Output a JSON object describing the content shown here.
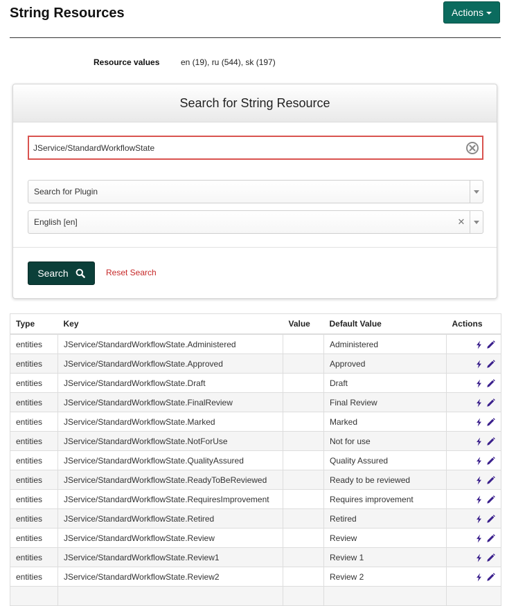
{
  "page": {
    "title": "String Resources",
    "actions_label": "Actions"
  },
  "resource_values": {
    "label": "Resource values",
    "value": "en (19), ru (544), sk (197)"
  },
  "search_panel": {
    "title": "Search for String Resource",
    "query_value": "JService/StandardWorkflowState",
    "plugin_select": "Search for Plugin",
    "language_select": "English [en]",
    "search_label": "Search",
    "reset_label": "Reset Search"
  },
  "table": {
    "headers": [
      "Type",
      "Key",
      "Value",
      "Default Value",
      "Actions"
    ],
    "rows": [
      {
        "type": "entities",
        "key": "JService/StandardWorkflowState.Administered",
        "value": "",
        "default": "Administered"
      },
      {
        "type": "entities",
        "key": "JService/StandardWorkflowState.Approved",
        "value": "",
        "default": "Approved"
      },
      {
        "type": "entities",
        "key": "JService/StandardWorkflowState.Draft",
        "value": "",
        "default": "Draft"
      },
      {
        "type": "entities",
        "key": "JService/StandardWorkflowState.FinalReview",
        "value": "",
        "default": "Final Review"
      },
      {
        "type": "entities",
        "key": "JService/StandardWorkflowState.Marked",
        "value": "",
        "default": "Marked"
      },
      {
        "type": "entities",
        "key": "JService/StandardWorkflowState.NotForUse",
        "value": "",
        "default": "Not for use"
      },
      {
        "type": "entities",
        "key": "JService/StandardWorkflowState.QualityAssured",
        "value": "",
        "default": "Quality Assured"
      },
      {
        "type": "entities",
        "key": "JService/StandardWorkflowState.ReadyToBeReviewed",
        "value": "",
        "default": "Ready to be reviewed"
      },
      {
        "type": "entities",
        "key": "JService/StandardWorkflowState.RequiresImprovement",
        "value": "",
        "default": "Requires improvement"
      },
      {
        "type": "entities",
        "key": "JService/StandardWorkflowState.Retired",
        "value": "",
        "default": "Retired"
      },
      {
        "type": "entities",
        "key": "JService/StandardWorkflowState.Review",
        "value": "",
        "default": "Review"
      },
      {
        "type": "entities",
        "key": "JService/StandardWorkflowState.Review1",
        "value": "",
        "default": "Review 1"
      },
      {
        "type": "entities",
        "key": "JService/StandardWorkflowState.Review2",
        "value": "",
        "default": "Review 2"
      },
      {
        "type": "",
        "key": "",
        "value": "",
        "default": ""
      }
    ]
  },
  "colors": {
    "primary": "#0b6b5e",
    "dark_primary": "#0b3f39",
    "error_border": "#d9534f",
    "link_red": "#c62828",
    "icon_purple": "#3a1f8c"
  },
  "icons": {
    "clear": "circle-x-icon",
    "search": "magnifier-icon",
    "caret": "caret-down-icon",
    "row_action_1": "bolt-icon",
    "row_action_2": "pencil-icon"
  }
}
